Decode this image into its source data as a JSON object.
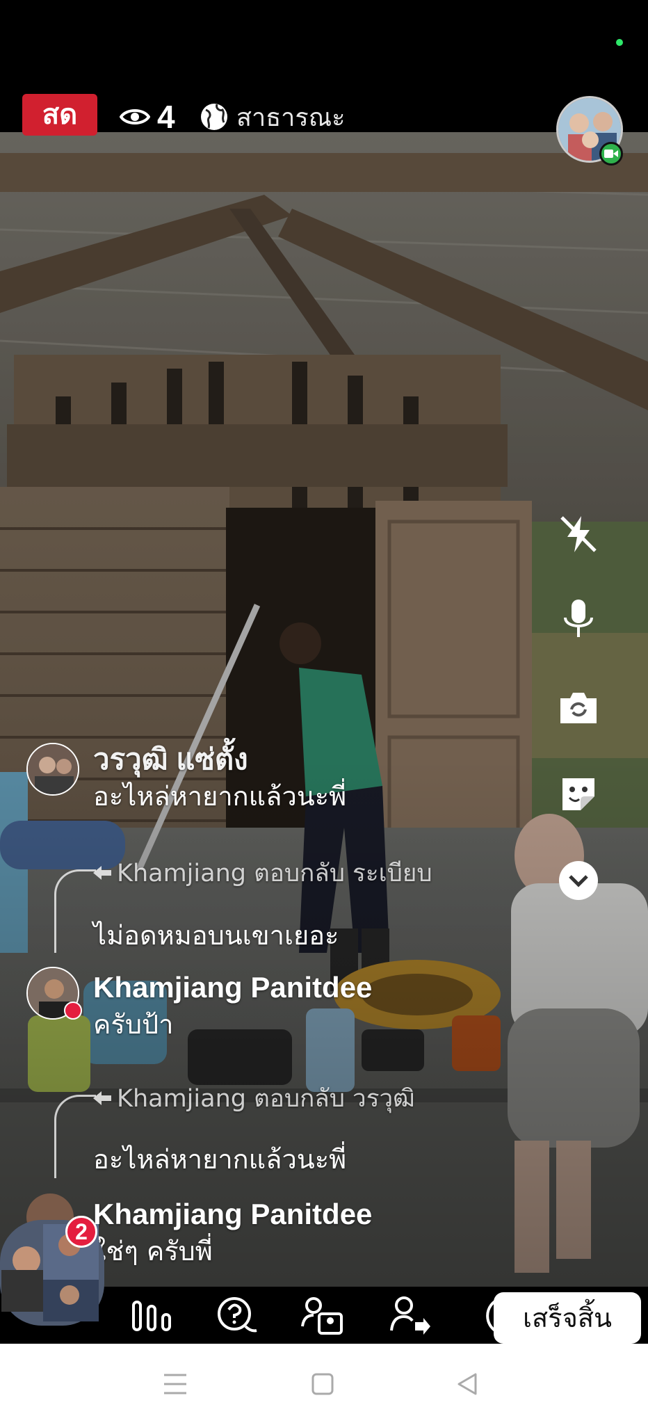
{
  "header": {
    "live_label": "สด",
    "viewer_count": "4",
    "privacy_label": "สาธารณะ",
    "icons": {
      "viewers": "eye-icon",
      "privacy": "globe-icon",
      "camera": "video-camera-icon"
    }
  },
  "controls": {
    "icons": [
      "flash-off-icon",
      "microphone-icon",
      "switch-camera-icon",
      "sticker-icon",
      "chevron-down-icon"
    ]
  },
  "comments": [
    {
      "type": "comment",
      "name": "วรวุฒิ แซ่ตั้ง",
      "text": "อะไหล่หายากแล้วนะพี่"
    },
    {
      "type": "reply_context",
      "text": "Khamjiang ตอบกลับ ระเบียบ"
    },
    {
      "type": "comment_text",
      "text": "ไม่อดหมอบนเขาเยอะ"
    },
    {
      "type": "comment",
      "name": "Khamjiang Panitdee",
      "text": "ครับป้า"
    },
    {
      "type": "reply_context",
      "text": "Khamjiang ตอบกลับ วรวุฒิ"
    },
    {
      "type": "comment_text",
      "text": "อะไหล่หายากแล้วนะพี่"
    },
    {
      "type": "comment",
      "name": "Khamjiang Panitdee",
      "text": "ใช่ๆ ครับพี่"
    }
  ],
  "bottom_bar": {
    "notification_count": "2",
    "finish_label": "เสร็จสิ้น",
    "icons": [
      "poll-icon",
      "question-icon",
      "guest-icon",
      "invite-icon",
      "more-icon"
    ]
  },
  "nav": {
    "icons": [
      "menu-icon",
      "home-icon",
      "back-icon"
    ]
  },
  "colors": {
    "live": "#d1202f",
    "badge": "#e41e3f",
    "camera_badge": "#2fb24c",
    "status_dot": "#2ee86a"
  }
}
